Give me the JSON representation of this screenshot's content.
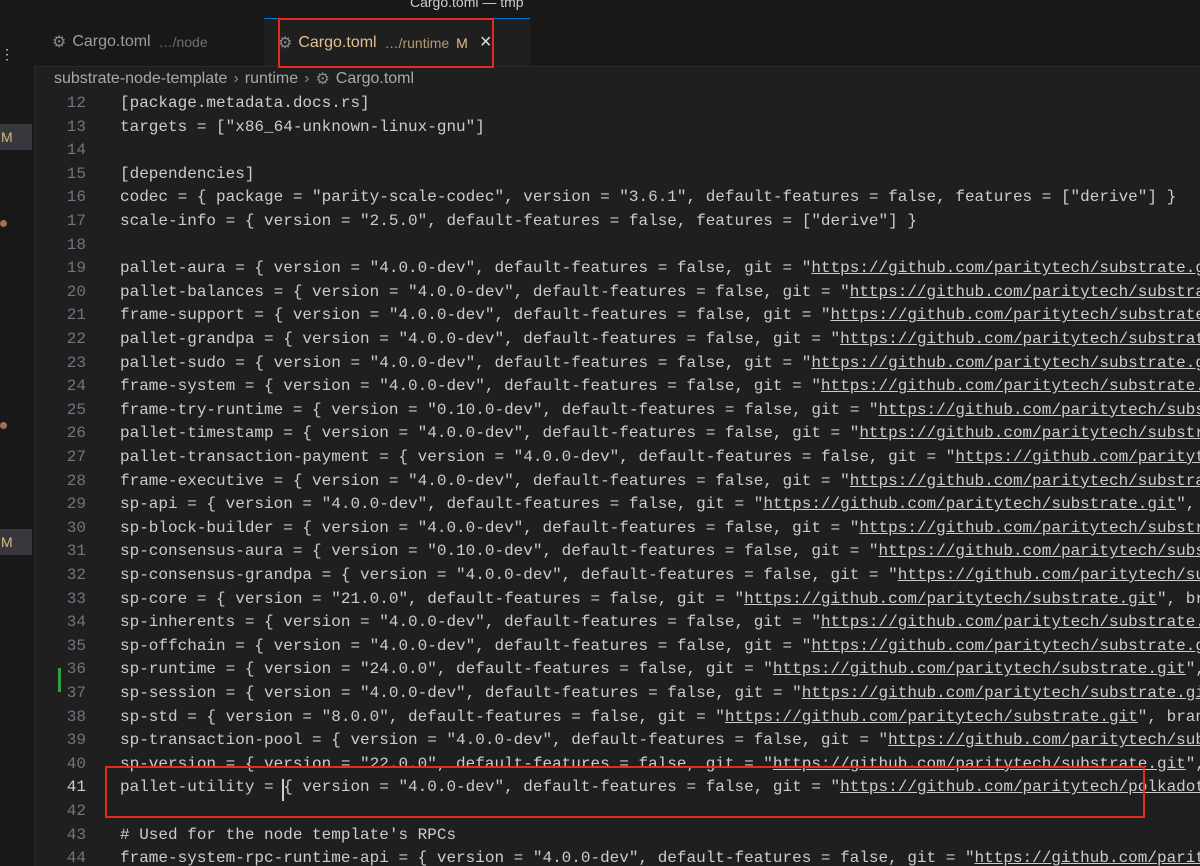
{
  "window": {
    "title": "Cargo.toml — tmp"
  },
  "activity_bar": {
    "dots": "⋮",
    "badge": "M"
  },
  "tabs": [
    {
      "label": "Cargo.toml",
      "path": "…/node",
      "icon": "gear-icon"
    },
    {
      "label": "Cargo.toml",
      "path": "…/runtime",
      "modified": "M",
      "close": "×",
      "icon": "gear-icon"
    }
  ],
  "breadcrumb": {
    "items": [
      "substrate-node-template",
      "runtime",
      "Cargo.toml"
    ],
    "separator": "›"
  },
  "editor": {
    "active_line": "41",
    "lines": [
      {
        "num": "12",
        "text": "[package.metadata.docs.rs]"
      },
      {
        "num": "13",
        "text": "targets = [\"x86_64-unknown-linux-gnu\"]"
      },
      {
        "num": "14",
        "text": ""
      },
      {
        "num": "15",
        "text": "[dependencies]"
      },
      {
        "num": "16",
        "text": "codec = { package = \"parity-scale-codec\", version = \"3.6.1\", default-features = false, features = [\"derive\"] }"
      },
      {
        "num": "17",
        "text": "scale-info = { version = \"2.5.0\", default-features = false, features = [\"derive\"] }"
      },
      {
        "num": "18",
        "text": ""
      },
      {
        "num": "19",
        "pre": "pallet-aura = { version = \"4.0.0-dev\", default-features = false, git = \"",
        "url": "https://github.com/paritytech/substrate.git"
      },
      {
        "num": "20",
        "pre": "pallet-balances = { version = \"4.0.0-dev\", default-features = false, git = \"",
        "url": "https://github.com/paritytech/substrate.git"
      },
      {
        "num": "21",
        "pre": "frame-support = { version = \"4.0.0-dev\", default-features = false, git = \"",
        "url": "https://github.com/paritytech/substrate.git"
      },
      {
        "num": "22",
        "pre": "pallet-grandpa = { version = \"4.0.0-dev\", default-features = false, git = \"",
        "url": "https://github.com/paritytech/substrate.git"
      },
      {
        "num": "23",
        "pre": "pallet-sudo = { version = \"4.0.0-dev\", default-features = false, git = \"",
        "url": "https://github.com/paritytech/substrate.git"
      },
      {
        "num": "24",
        "pre": "frame-system = { version = \"4.0.0-dev\", default-features = false, git = \"",
        "url": "https://github.com/paritytech/substrate.git"
      },
      {
        "num": "25",
        "pre": "frame-try-runtime = { version = \"0.10.0-dev\", default-features = false, git = \"",
        "url": "https://github.com/paritytech/substrate.git"
      },
      {
        "num": "26",
        "pre": "pallet-timestamp = { version = \"4.0.0-dev\", default-features = false, git = \"",
        "url": "https://github.com/paritytech/substrate.git"
      },
      {
        "num": "27",
        "pre": "pallet-transaction-payment = { version = \"4.0.0-dev\", default-features = false, git = \"",
        "url": "https://github.com/paritytech/substrate.git"
      },
      {
        "num": "28",
        "pre": "frame-executive = { version = \"4.0.0-dev\", default-features = false, git = \"",
        "url": "https://github.com/paritytech/substrate.git"
      },
      {
        "num": "29",
        "pre": "sp-api = { version = \"4.0.0-dev\", default-features = false, git = \"",
        "url": "https://github.com/paritytech/substrate.git",
        "post": "\", b"
      },
      {
        "num": "30",
        "pre": "sp-block-builder = { version = \"4.0.0-dev\", default-features = false, git = \"",
        "url": "https://github.com/paritytech/substrate.git"
      },
      {
        "num": "31",
        "pre": "sp-consensus-aura = { version = \"0.10.0-dev\", default-features = false, git = \"",
        "url": "https://github.com/paritytech/substrate.git"
      },
      {
        "num": "32",
        "pre": "sp-consensus-grandpa = { version = \"4.0.0-dev\", default-features = false, git = \"",
        "url": "https://github.com/paritytech/substrate.git"
      },
      {
        "num": "33",
        "pre": "sp-core = { version = \"21.0.0\", default-features = false, git = \"",
        "url": "https://github.com/paritytech/substrate.git",
        "post": "\", bra"
      },
      {
        "num": "34",
        "pre": "sp-inherents = { version = \"4.0.0-dev\", default-features = false, git = \"",
        "url": "https://github.com/paritytech/substrate.git"
      },
      {
        "num": "35",
        "pre": "sp-offchain = { version = \"4.0.0-dev\", default-features = false, git = \"",
        "url": "https://github.com/paritytech/substrate.git"
      },
      {
        "num": "36",
        "pre": "sp-runtime = { version = \"24.0.0\", default-features = false, git = \"",
        "url": "https://github.com/paritytech/substrate.git",
        "post": "\","
      },
      {
        "num": "37",
        "pre": "sp-session = { version = \"4.0.0-dev\", default-features = false, git = \"",
        "url": "https://github.com/paritytech/substrate.git"
      },
      {
        "num": "38",
        "pre": "sp-std = { version = \"8.0.0\", default-features = false, git = \"",
        "url": "https://github.com/paritytech/substrate.git",
        "post": "\", branc"
      },
      {
        "num": "39",
        "pre": "sp-transaction-pool = { version = \"4.0.0-dev\", default-features = false, git = \"",
        "url": "https://github.com/paritytech/substrate.git"
      },
      {
        "num": "40",
        "pre": "sp-version = { version = \"22.0.0\", default-features = false, git = \"",
        "url": "https://github.com/paritytech/substrate.git",
        "post": "\","
      },
      {
        "num": "41",
        "pre": "pallet-utility = { version = \"4.0.0-dev\", default-features = false, git = \"",
        "url": "https://github.com/paritytech/polkadot-sdk"
      },
      {
        "num": "42",
        "text": ""
      },
      {
        "num": "43",
        "text": "# Used for the node template's RPCs"
      },
      {
        "num": "44",
        "pre": "frame-system-rpc-runtime-api = { version = \"4.0.0-dev\", default-features = false, git = \"",
        "url": "https://github.com/paritytech/substrate.git"
      }
    ]
  }
}
